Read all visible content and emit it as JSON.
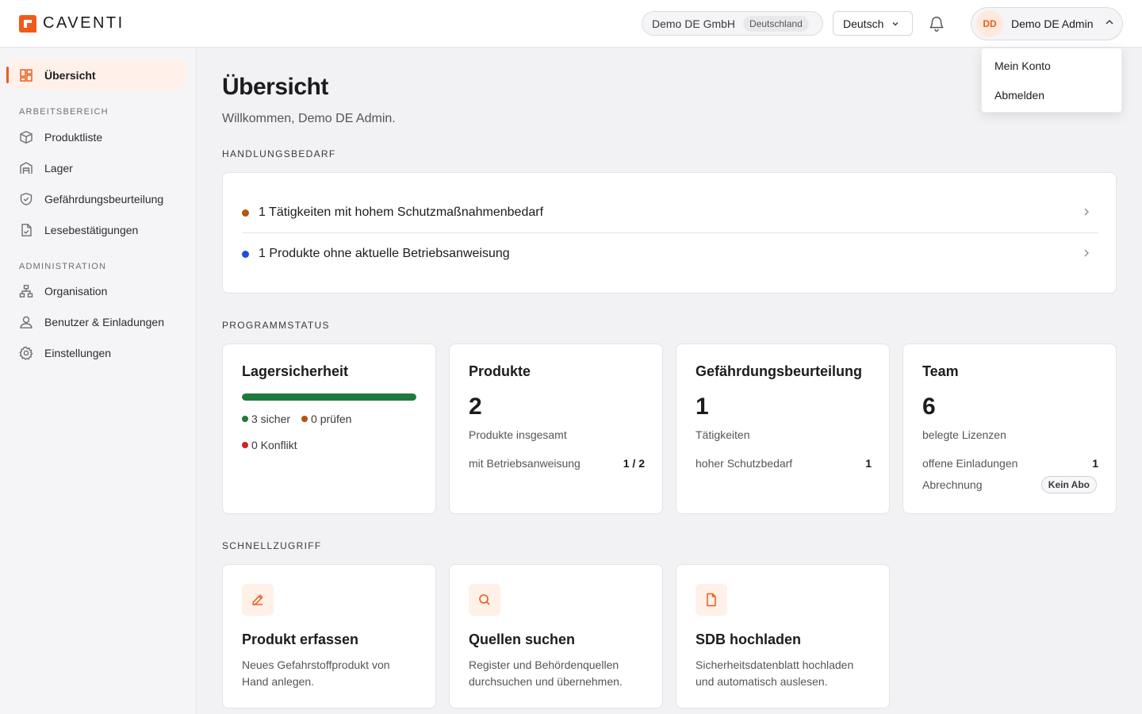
{
  "brand": {
    "name": "CAVENTI",
    "accent": "#f05a1a"
  },
  "header": {
    "org_name": "Demo DE GmbH",
    "org_country": "Deutschland",
    "language": "Deutsch",
    "user_initials": "DD",
    "user_name": "Demo DE Admin",
    "bell_icon": "bell-icon"
  },
  "user_menu": {
    "items": [
      {
        "label": "Mein Konto"
      },
      {
        "label": "Abmelden"
      }
    ]
  },
  "sidebar": {
    "active": {
      "label": "Übersicht",
      "icon": "dashboard-icon"
    },
    "sections": [
      {
        "title": "ARBEITSBEREICH",
        "items": [
          {
            "label": "Produktliste",
            "icon": "box-icon"
          },
          {
            "label": "Lager",
            "icon": "warehouse-icon"
          },
          {
            "label": "Gefährdungsbeurteilung",
            "icon": "shield-icon"
          },
          {
            "label": "Lesebestätigungen",
            "icon": "file-check-icon"
          }
        ]
      },
      {
        "title": "ADMINISTRATION",
        "items": [
          {
            "label": "Organisation",
            "icon": "org-chart-icon"
          },
          {
            "label": "Benutzer & Einladungen",
            "icon": "user-icon"
          },
          {
            "label": "Einstellungen",
            "icon": "gear-icon"
          }
        ]
      }
    ]
  },
  "main": {
    "title": "Übersicht",
    "welcome": "Willkommen, Demo DE Admin.",
    "action_section": "HANDLUNGSBEDARF",
    "actions": [
      {
        "text": "1 Tätigkeiten mit hohem Schutzmaßnahmenbedarf",
        "color": "#b5530f"
      },
      {
        "text": "1 Produkte ohne aktuelle Betriebsanweisung",
        "color": "#1d4ed8"
      }
    ],
    "status_section": "PROGRAMMSTATUS",
    "status": {
      "lager": {
        "title": "Lagersicherheit",
        "progress_fraction": 1.0,
        "progress_color": "#1f7a3c",
        "sicher": "3 sicher",
        "pruefen": "0 prüfen",
        "konflikt": "0 Konflikt",
        "colors": {
          "sicher": "#1f7a3c",
          "pruefen": "#b5530f",
          "konflikt": "#c62828"
        }
      },
      "produkte": {
        "title": "Produkte",
        "value": "2",
        "caption": "Produkte insgesamt",
        "row_label": "mit Betriebsanweisung",
        "row_value": "1 / 2"
      },
      "gefaehrdung": {
        "title": "Gefährdungsbeurteilung",
        "value": "1",
        "caption": "Tätigkeiten",
        "row_label": "hoher Schutzbedarf",
        "row_value": "1"
      },
      "team": {
        "title": "Team",
        "value": "6",
        "caption": "belegte Lizenzen",
        "row1_label": "offene Einladungen",
        "row1_value": "1",
        "row2_label": "Abrechnung",
        "row2_badge": "Kein Abo"
      }
    },
    "quick_section": "SCHNELLZUGRIFF",
    "quick": [
      {
        "title": "Produkt erfassen",
        "desc": "Neues Gefahrstoffprodukt von Hand anlegen.",
        "icon": "pencil-icon"
      },
      {
        "title": "Quellen suchen",
        "desc": "Register und Behördenquellen durchsuchen und übernehmen.",
        "icon": "search-icon"
      },
      {
        "title": "SDB hochladen",
        "desc": "Sicherheitsdatenblatt hochladen und automatisch auslesen.",
        "icon": "file-icon"
      }
    ]
  }
}
